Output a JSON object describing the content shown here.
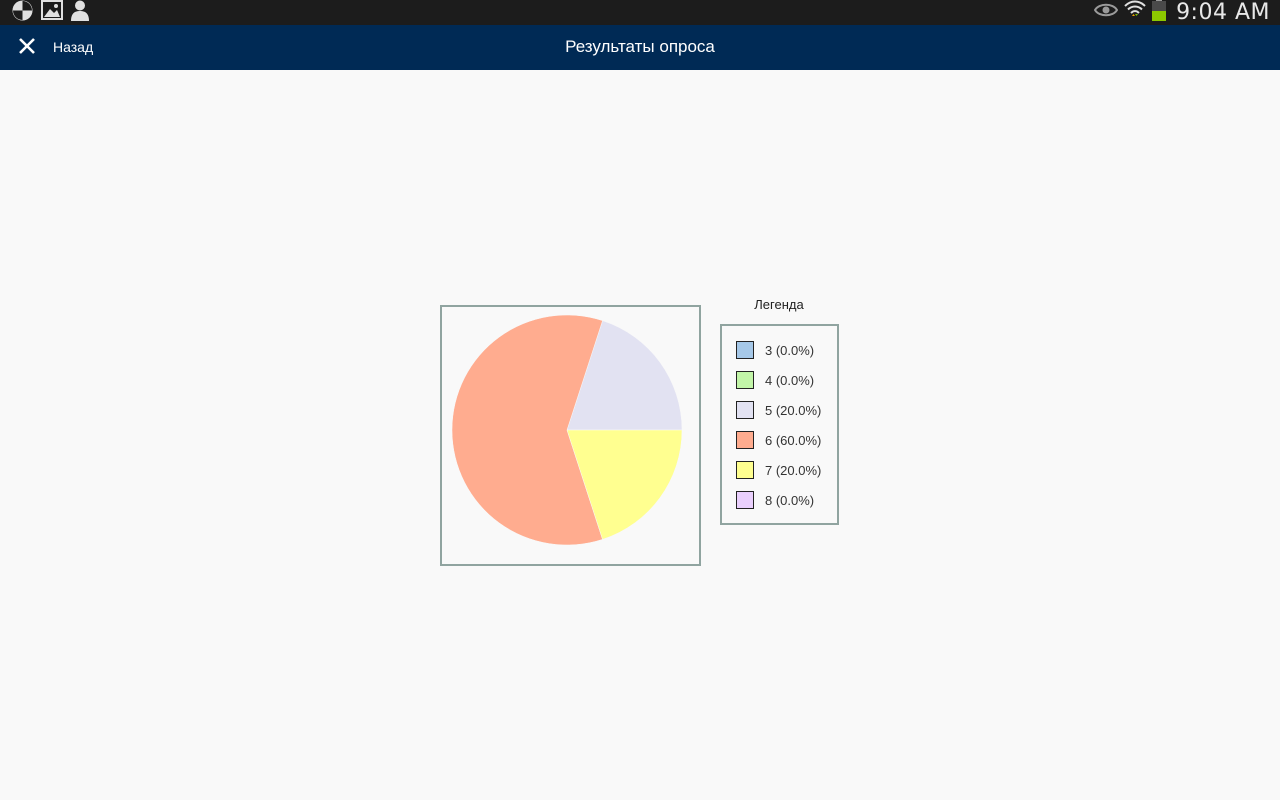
{
  "status_bar": {
    "time": "9:04 AM",
    "left_icons": [
      "pinwheel-icon",
      "gallery-icon",
      "person-icon"
    ],
    "right_icons": [
      "eye-icon",
      "wifi-icon",
      "battery-icon"
    ]
  },
  "app_bar": {
    "back_label": "Назад",
    "title": "Результаты опроса",
    "close_icon": "close-icon",
    "background": "#002a55"
  },
  "chart_data": {
    "type": "pie",
    "legend_title": "Легенда",
    "legend_placement": "right",
    "slices": [
      {
        "label": "3 (0.0%)",
        "value": 0.0,
        "color": "#a6c8e8"
      },
      {
        "label": "4 (0.0%)",
        "value": 0.0,
        "color": "#c2f5a8"
      },
      {
        "label": "5 (20.0%)",
        "value": 20.0,
        "color": "#e2e2f2"
      },
      {
        "label": "6 (60.0%)",
        "value": 60.0,
        "color": "#ffac8f"
      },
      {
        "label": "7 (20.0%)",
        "value": 20.0,
        "color": "#ffff90"
      },
      {
        "label": "8 (0.0%)",
        "value": 0.0,
        "color": "#ead0fd"
      }
    ]
  }
}
